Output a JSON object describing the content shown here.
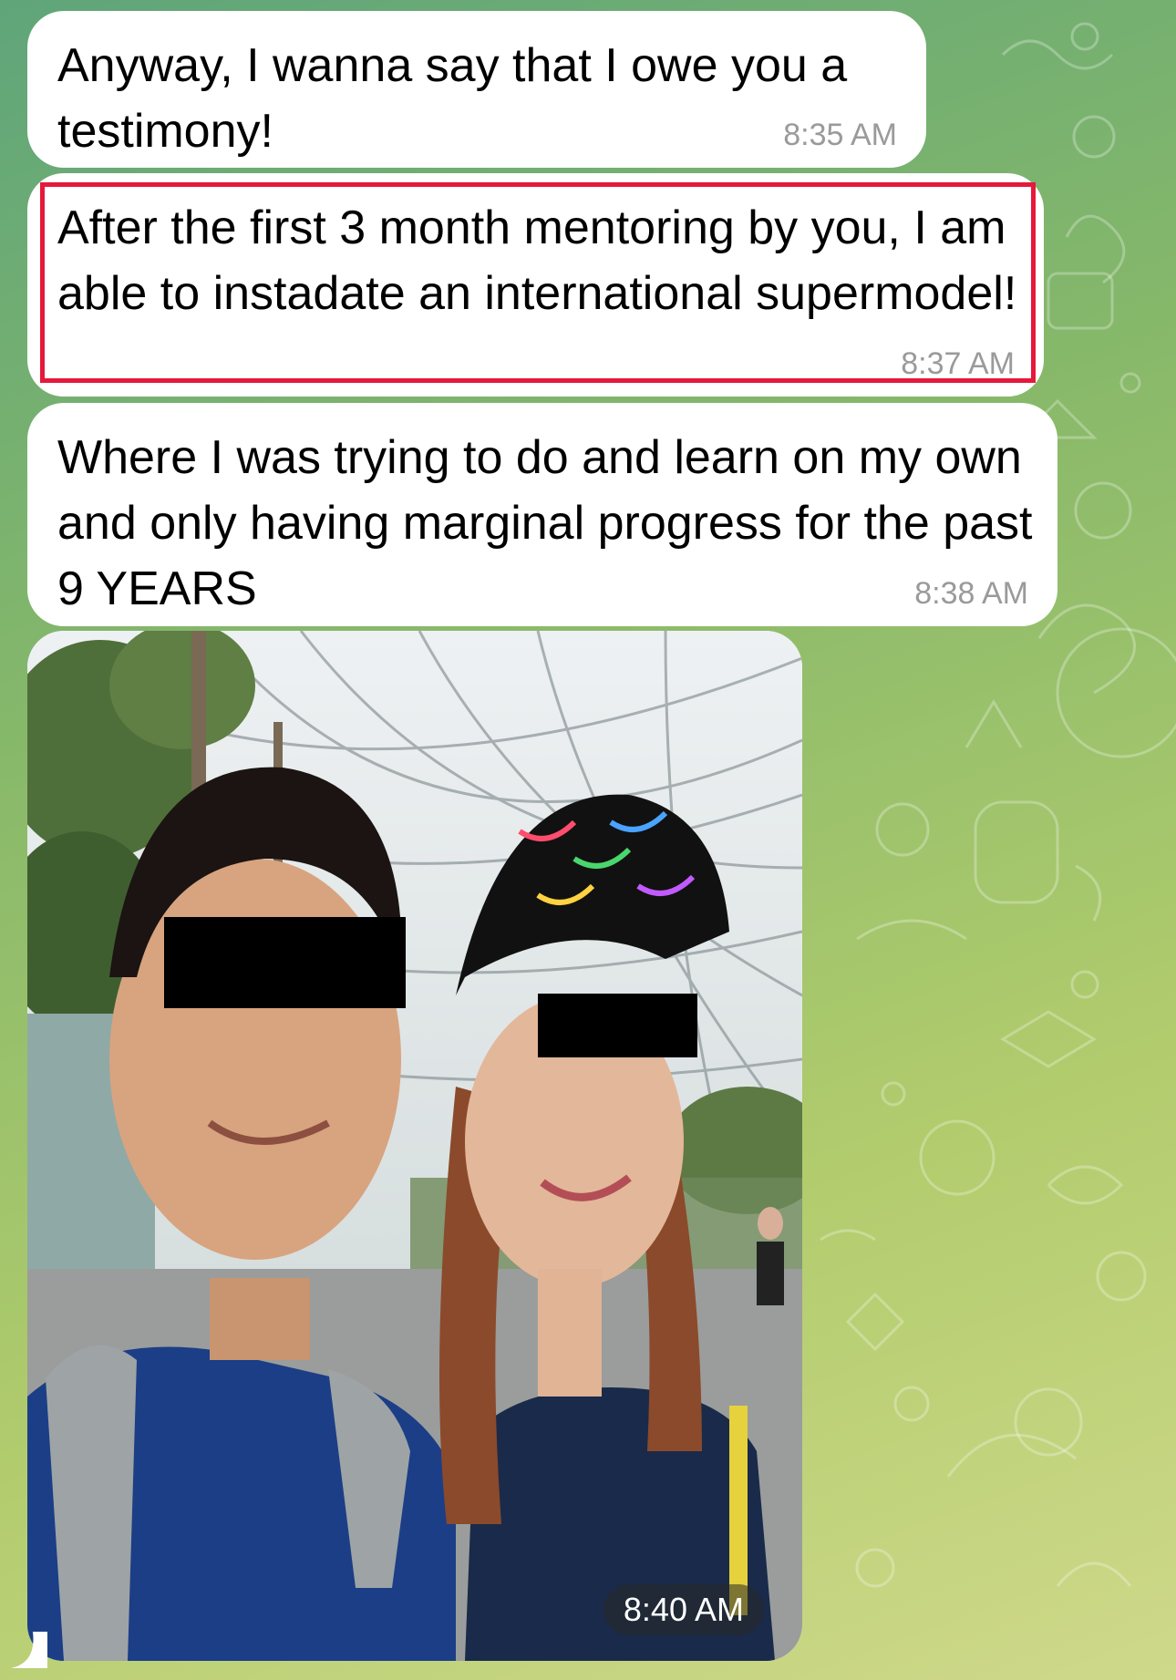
{
  "colors": {
    "bubble": "#ffffff",
    "timestamp": "#9a9a9a",
    "highlight_border": "#e5193b",
    "wallpaper_start": "#5fa57a",
    "wallpaper_end": "#cfd98a"
  },
  "messages": [
    {
      "text": "Anyway, I wanna say that I owe you a testimony!",
      "time": "8:35 AM"
    },
    {
      "text": "After the first 3 month mentoring by you, I am able to instadate an international supermodel!",
      "time": "8:37 AM",
      "highlighted": true
    },
    {
      "text": "Where I was trying to do and learn on my own and only having marginal progress for the past 9 YEARS",
      "time": "8:38 AM"
    }
  ],
  "photo_message": {
    "time": "8:40 AM",
    "image_icon": "selfie-photo"
  }
}
